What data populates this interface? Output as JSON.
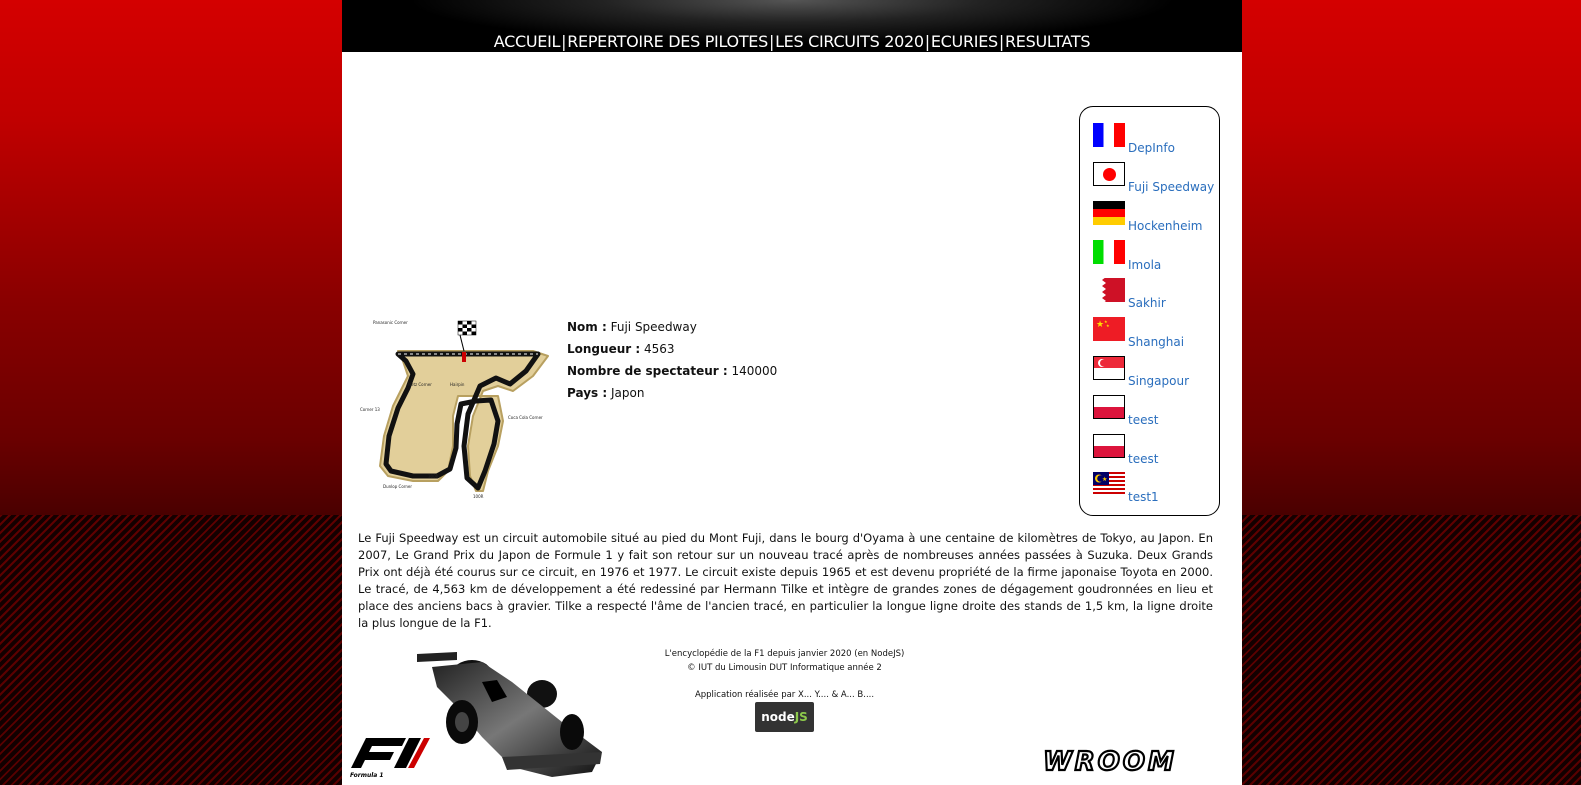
{
  "nav": {
    "items": [
      {
        "label": "ACCUEIL"
      },
      {
        "label": "REPERTOIRE DES PILOTES"
      },
      {
        "label": "LES CIRCUITS 2020"
      },
      {
        "label": "ECURIES"
      },
      {
        "label": "RESULTATS"
      }
    ],
    "separator": "|"
  },
  "circuits": [
    {
      "label": "DepInfo",
      "flag": "france-flag"
    },
    {
      "label": "Fuji Speedway",
      "flag": "japan-flag"
    },
    {
      "label": "Hockenheim",
      "flag": "germany-flag"
    },
    {
      "label": "Imola",
      "flag": "italy-flag"
    },
    {
      "label": "Sakhir",
      "flag": "bahrain-flag"
    },
    {
      "label": "Shanghai",
      "flag": "china-flag"
    },
    {
      "label": "Singapour",
      "flag": "singapore-flag"
    },
    {
      "label": "teest",
      "flag": "poland-flag"
    },
    {
      "label": "teest",
      "flag": "poland-flag"
    },
    {
      "label": "test1",
      "flag": "malaysia-flag"
    }
  ],
  "circuit": {
    "name_label": "Nom :",
    "name": "Fuji Speedway",
    "length_label": "Longueur :",
    "length": "4563",
    "spectators_label": "Nombre de spectateur :",
    "spectators": "140000",
    "country_label": "Pays :",
    "country": "Japon",
    "map_labels": {
      "panasonic": "Panasonic Corner",
      "netz": "Netz Corner",
      "hairpin": "Hairpin",
      "corner13": "Corner 13",
      "coca": "Coca Cola Corner",
      "dunlop": "Dunlop Corner",
      "c300r": "300R",
      "c100r": "100R"
    },
    "description": "Le Fuji Speedway est un circuit automobile situé au pied du Mont Fuji, dans le bourg d'Oyama à une centaine de kilomètres de Tokyo, au Japon. En 2007, Le Grand Prix du Japon de Formule 1 y fait son retour sur un nouveau tracé après de nombreuses années passées à Suzuka. Deux Grands Prix ont déjà été courus sur ce circuit, en 1976 et 1977. Le circuit existe depuis 1965 et est devenu propriété de la firme japonaise Toyota en 2000. Le tracé, de 4,563 km de développement a été redessiné par Hermann Tilke et intègre de grandes zones de dégagement goudronnées en lieu et place des anciens bacs à gravier. Tilke a respecté l'âme de l'ancien tracé, en particulier la longue ligne droite des stands de 1,5 km, la ligne droite la plus longue de la F1."
  },
  "footer": {
    "line1": "L'encyclopédie de la F1 depuis janvier 2020 (en NodeJS)",
    "line2": "© IUT du Limousin DUT Informatique année 2",
    "line3": "Application réalisée par X... Y.... & A... B....",
    "nodejs_text_node": "node",
    "nodejs_text_js": "JS",
    "wroom": "WROOM",
    "f1_caption": "Formula 1"
  },
  "colors": {
    "link": "#2a6ebd",
    "banner": "#000000",
    "background_red": "#c00000"
  }
}
